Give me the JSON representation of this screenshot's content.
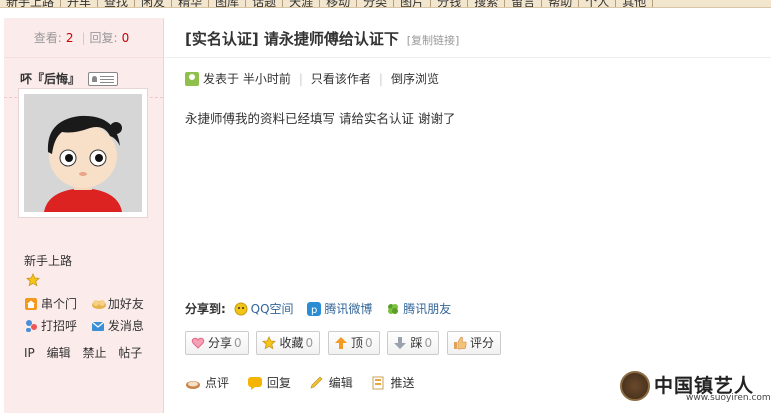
{
  "topnav": [
    "新手上路",
    "开车",
    "查找",
    "闲友",
    "精华",
    "图库",
    "话题",
    "天涯",
    "移动",
    "分类",
    "图片",
    "分钱",
    "搜索",
    "留言",
    "帮助",
    "个人",
    "其他"
  ],
  "sidebar": {
    "views_label": "查看:",
    "views": "2",
    "replies_label": "回复:",
    "replies": "0",
    "username": "吥『后悔』",
    "rank": "新手上路",
    "actions": [
      {
        "label": "串个门",
        "icon": "home-icon"
      },
      {
        "label": "加好友",
        "icon": "add-friend-icon"
      },
      {
        "label": "打招呼",
        "icon": "greet-icon"
      },
      {
        "label": "发消息",
        "icon": "message-icon"
      }
    ],
    "admin": [
      "IP",
      "编辑",
      "禁止",
      "帖子"
    ]
  },
  "thread": {
    "title": "[实名认证] 请永捷师傅给认证下",
    "copy_link": "[复制链接]",
    "posted": "发表于 半小时前",
    "only_author": "只看该作者",
    "reverse": "倒序浏览",
    "content": "永捷师傅我的资料已经填写 请给实名认证 谢谢了"
  },
  "share": {
    "label": "分享到:",
    "items": [
      {
        "label": "QQ空间",
        "icon": "qzone-icon",
        "color": "#f0b400"
      },
      {
        "label": "腾讯微博",
        "icon": "tencent-weibo-icon",
        "color": "#2a8dd4"
      },
      {
        "label": "腾讯朋友",
        "icon": "tencent-friend-icon",
        "color": "#5a9e2a"
      }
    ]
  },
  "buttons": [
    {
      "label": "分享",
      "count": "0",
      "icon": "heart-icon"
    },
    {
      "label": "收藏",
      "count": "0",
      "icon": "star-icon"
    },
    {
      "label": "顶",
      "count": "0",
      "icon": "arrow-up-icon"
    },
    {
      "label": "踩",
      "count": "0",
      "icon": "arrow-down-icon"
    },
    {
      "label": "评分",
      "count": "",
      "icon": "thumb-icon"
    }
  ],
  "bottom": [
    {
      "label": "点评",
      "icon": "comment-icon"
    },
    {
      "label": "回复",
      "icon": "reply-icon"
    },
    {
      "label": "编辑",
      "icon": "edit-icon"
    },
    {
      "label": "推送",
      "icon": "push-icon"
    }
  ],
  "watermark": {
    "text": "中国镇艺人",
    "url": "www.suoyiren.com"
  },
  "colors": {
    "sidebar_bg": "#fcebeb",
    "accent_red": "#cc0000",
    "link": "#336699"
  }
}
